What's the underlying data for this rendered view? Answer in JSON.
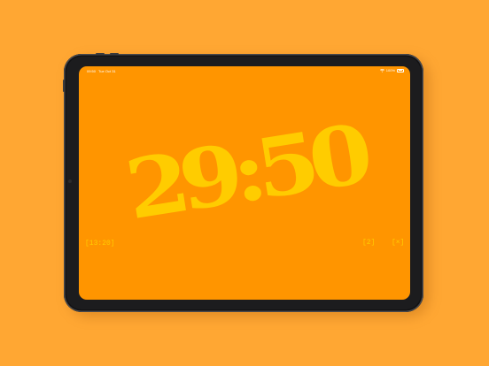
{
  "colors": {
    "background": "#ffa733",
    "screen": "#ff9500",
    "accent": "#ffcc00",
    "device_bezel": "#1c1c1e"
  },
  "status_bar": {
    "time": "09:50",
    "date": "Tue Oct 31",
    "battery": "100%",
    "icons": [
      "wifi-icon",
      "battery-icon"
    ]
  },
  "timer": {
    "display": "29:50",
    "elapsed": "[13:20]"
  },
  "controls": {
    "edit_label": "[2]",
    "close_label": "[×]"
  }
}
